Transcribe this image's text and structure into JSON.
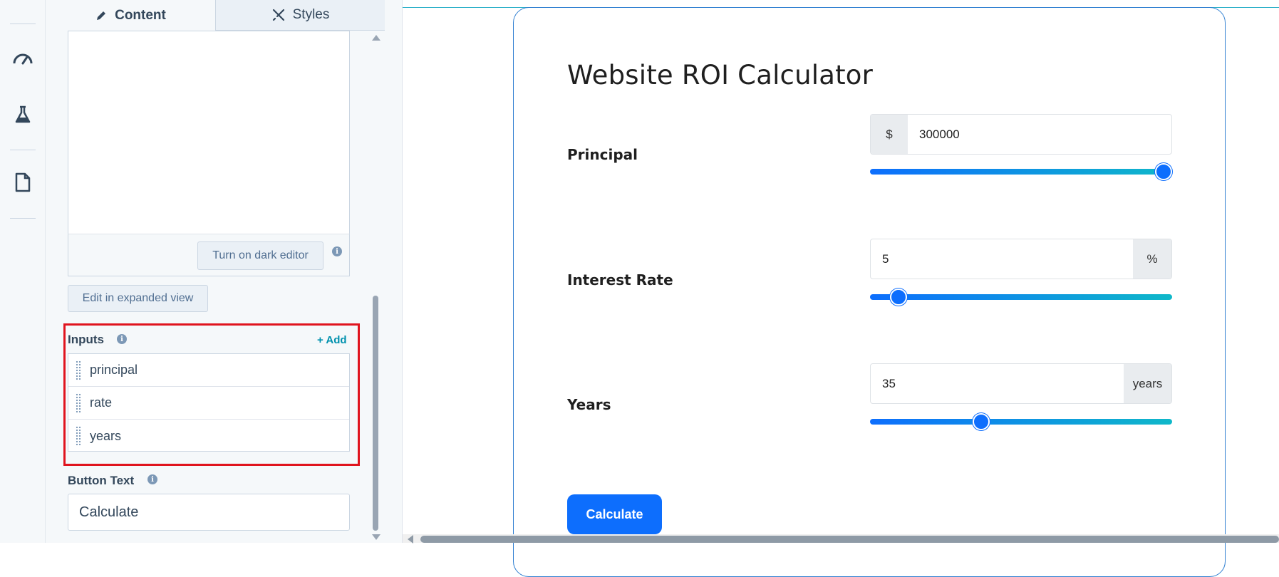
{
  "editor": {
    "tabs": [
      {
        "label": "Content",
        "icon": "pencil-icon",
        "active": true
      },
      {
        "label": "Styles",
        "icon": "brush-icon",
        "active": false
      }
    ],
    "dark_editor_button": "Turn on dark editor",
    "expanded_view_button": "Edit in expanded view",
    "inputs": {
      "label": "Inputs",
      "add_link": "+ Add",
      "items": [
        "principal",
        "rate",
        "years"
      ]
    },
    "button_text": {
      "label": "Button Text",
      "value": "Calculate"
    }
  },
  "rail": {
    "icons": [
      "speedometer-icon",
      "flask-icon",
      "document-icon"
    ]
  },
  "preview": {
    "title": "Website ROI Calculator",
    "fields": [
      {
        "label": "Principal",
        "value": "300000",
        "prefix": "$",
        "suffix": "",
        "slider_fraction": 1.0
      },
      {
        "label": "Interest Rate",
        "value": "5",
        "prefix": "",
        "suffix": "%",
        "slider_fraction": 0.07
      },
      {
        "label": "Years",
        "value": "35",
        "prefix": "",
        "suffix": "years",
        "slider_fraction": 0.36
      }
    ],
    "calculate_button": "Calculate"
  },
  "colors": {
    "accent": "#0d6efd",
    "highlight": "#e0141e",
    "link": "#0091ae"
  }
}
